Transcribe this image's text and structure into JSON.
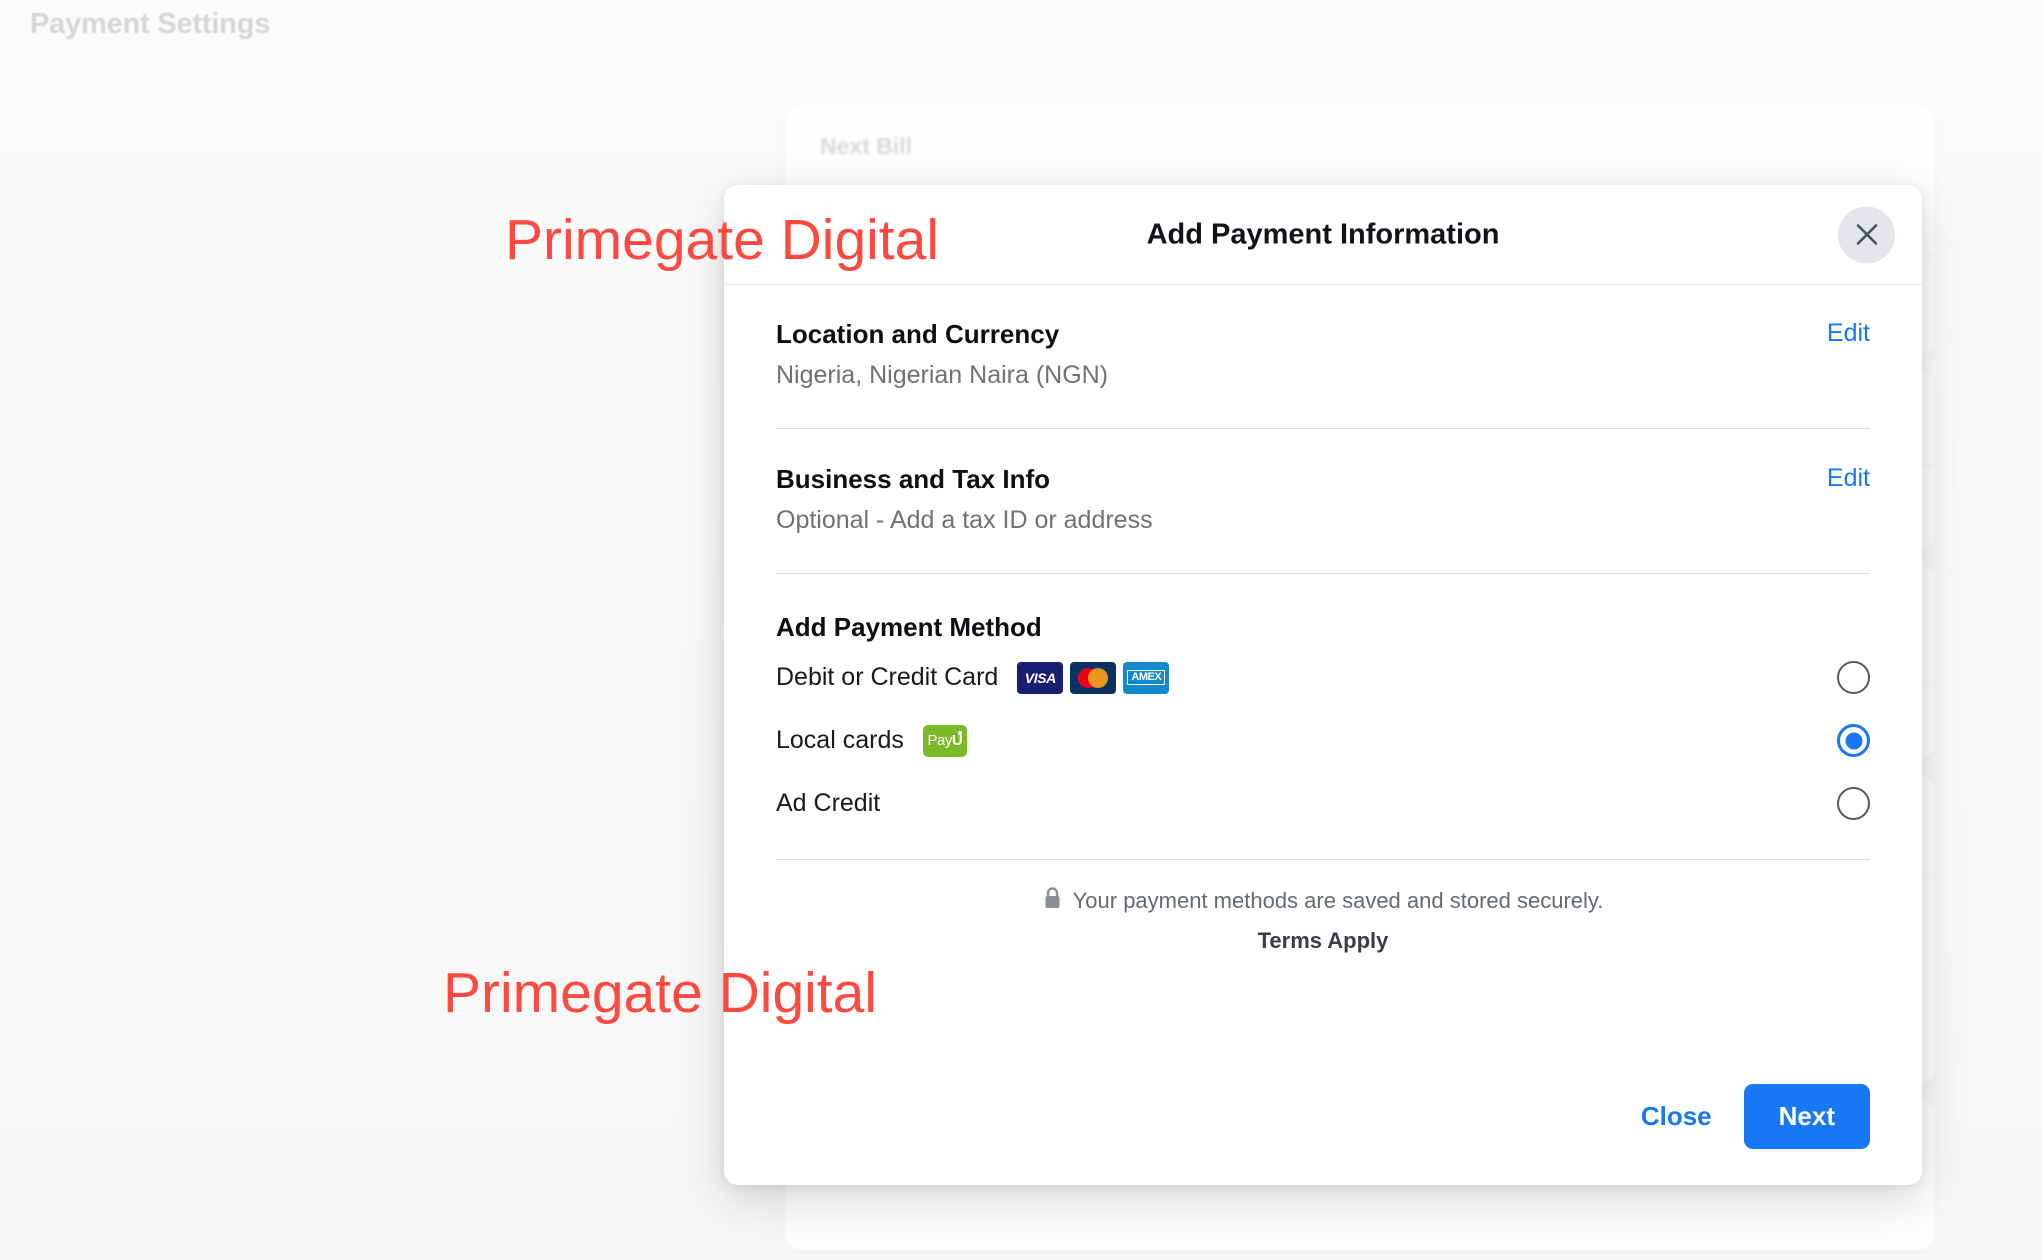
{
  "background": {
    "page_title": "Payment Settings",
    "next_bill_card_title": "Next Bill"
  },
  "watermarks": {
    "top": "Primegate Digital",
    "bottom": "Primegate Digital",
    "color": "#fc4a41"
  },
  "modal": {
    "title": "Add Payment Information",
    "close_icon": "close-icon",
    "sections": [
      {
        "title": "Location and Currency",
        "subtitle": "Nigeria, Nigerian Naira (NGN)",
        "action_label": "Edit"
      },
      {
        "title": "Business and Tax Info",
        "subtitle": "Optional - Add a tax ID or address",
        "action_label": "Edit"
      }
    ],
    "payment_method": {
      "heading": "Add Payment Method",
      "options": [
        {
          "label": "Debit or Credit Card",
          "selected": false,
          "logos": [
            {
              "name": "visa-logo",
              "text": "VISA"
            },
            {
              "name": "mastercard-logo",
              "text": ""
            },
            {
              "name": "amex-logo",
              "text": "AMEX"
            }
          ]
        },
        {
          "label": "Local cards",
          "selected": true,
          "logos": [
            {
              "name": "payu-logo",
              "text_light": "Pay",
              "text_bold": "U"
            }
          ]
        },
        {
          "label": "Ad Credit",
          "selected": false,
          "logos": []
        }
      ]
    },
    "secure_note": {
      "icon": "lock-icon",
      "text": "Your payment methods are saved and stored securely.",
      "terms": "Terms Apply"
    },
    "footer": {
      "close_label": "Close",
      "next_label": "Next",
      "accent_color": "#1877f2"
    }
  }
}
